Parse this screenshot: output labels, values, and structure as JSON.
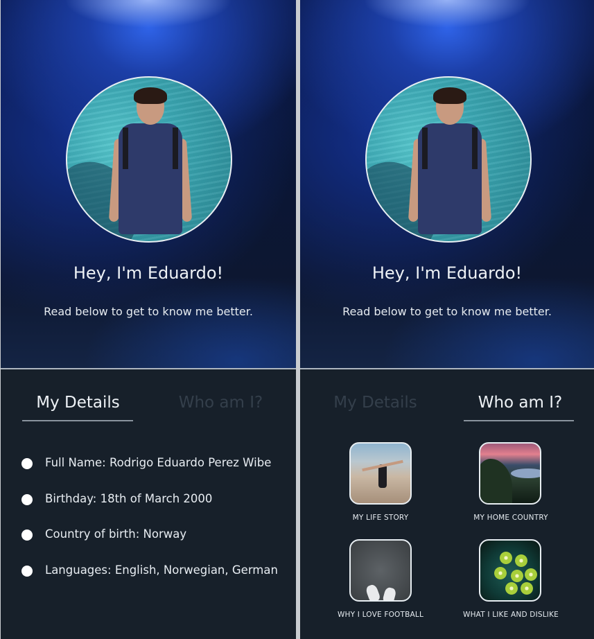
{
  "profile": {
    "greeting": "Hey, I'm Eduardo!",
    "subtitle": "Read below to get to know me better."
  },
  "tabs": [
    {
      "label": "My Details"
    },
    {
      "label": "Who am I?"
    }
  ],
  "details": [
    {
      "text": "Full Name: Rodrigo Eduardo Perez Wibe"
    },
    {
      "text": "Birthday: 18th of March 2000"
    },
    {
      "text": "Country of birth: Norway"
    },
    {
      "text": "Languages: English, Norwegian, German"
    }
  ],
  "tiles": [
    {
      "label": "MY LIFE STORY",
      "icon": "life-story-photo"
    },
    {
      "label": "MY HOME COUNTRY",
      "icon": "home-country-photo"
    },
    {
      "label": "WHY I LOVE FOOTBALL",
      "icon": "football-photo"
    },
    {
      "label": "WHAT I LIKE AND DISLIKE",
      "icon": "likes-dislikes-photo"
    }
  ],
  "colors": {
    "hero_blue": "#2f63e8",
    "panel_bg": "#17202a",
    "active_tab": "#eef2f6",
    "inactive_tab": "#343f4b"
  }
}
